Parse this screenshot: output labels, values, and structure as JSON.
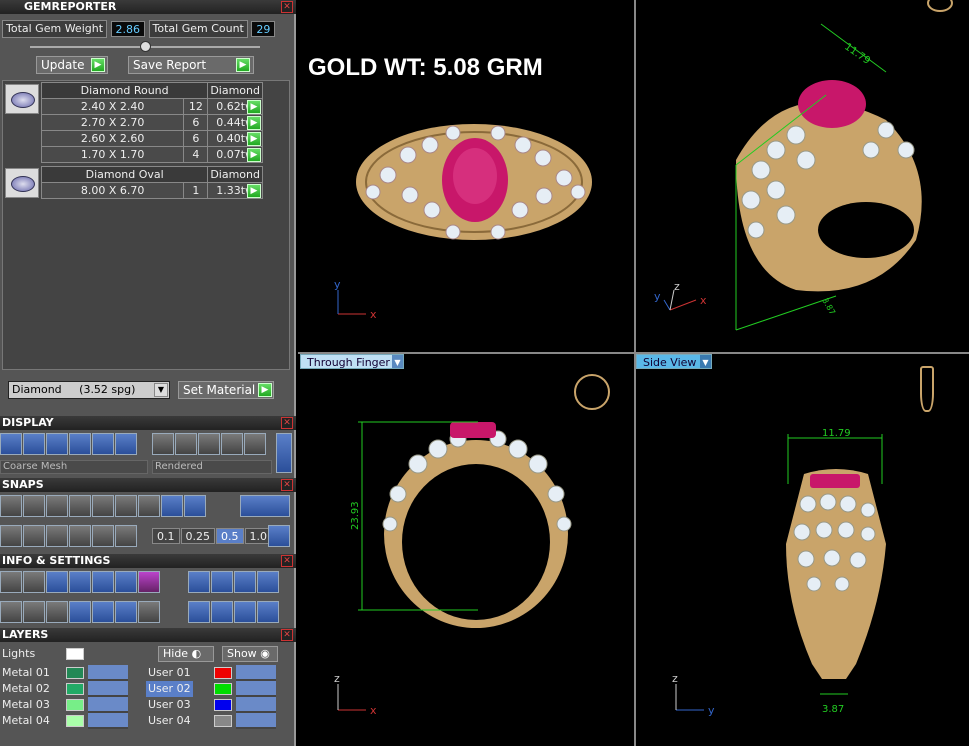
{
  "panel": {
    "title": "GEMREPORTER",
    "total_weight_label": "Total Gem Weight",
    "total_weight_value": "2.86",
    "total_count_label": "Total Gem Count",
    "total_count_value": "29",
    "update_label": "Update",
    "save_report_label": "Save Report",
    "groups": [
      {
        "header": [
          "Diamond Round",
          "Diamond"
        ],
        "rows": [
          [
            "2.40 X 2.40",
            "12",
            "0.62tw"
          ],
          [
            "2.70 X 2.70",
            "6",
            "0.44tw"
          ],
          [
            "2.60 X 2.60",
            "6",
            "0.40tw"
          ],
          [
            "1.70 X 1.70",
            "4",
            "0.07tw"
          ]
        ]
      },
      {
        "header": [
          "Diamond Oval",
          "Diamond"
        ],
        "rows": [
          [
            "8.00 X 6.70",
            "1",
            "1.33tw"
          ]
        ]
      }
    ],
    "material_select": "Diamond     (3.52 spg)",
    "set_material_label": "Set Material"
  },
  "display": {
    "title": "DISPLAY",
    "mesh_select": "Coarse Mesh",
    "render_select": "Rendered"
  },
  "snaps": {
    "title": "SNAPS",
    "values": [
      "0.1",
      "0.25",
      "0.5",
      "1.0"
    ]
  },
  "info": {
    "title": "INFO & SETTINGS"
  },
  "layers": {
    "title": "LAYERS",
    "lights_label": "Lights",
    "hide_label": "Hide",
    "show_label": "Show",
    "metal": [
      {
        "name": "Metal 01",
        "color": "#228855"
      },
      {
        "name": "Metal 02",
        "color": "#22aa66"
      },
      {
        "name": "Metal 03",
        "color": "#77ee88"
      },
      {
        "name": "Metal 04",
        "color": "#aaffaa"
      }
    ],
    "user": [
      {
        "name": "User 01",
        "color": "#ee0000"
      },
      {
        "name": "User 02",
        "color": "#00dd00"
      },
      {
        "name": "User 03",
        "color": "#0000ee"
      },
      {
        "name": "User 04",
        "color": "#888888"
      }
    ]
  },
  "viewports": {
    "gold_weight": "GOLD WT: 5.08 GRM",
    "bottom_left_label": "Through Finger",
    "bottom_right_label": "Side View",
    "dim_top_right": "11.79",
    "dim_top_right_small": "3.87",
    "dim_height": "23.93",
    "dim_side_width": "11.79",
    "dim_side_bottom": "3.87",
    "axis_x": "x",
    "axis_y": "y",
    "axis_z": "z"
  },
  "colors": {
    "gold": "#c9a46a",
    "ruby": "#c8176a",
    "dimension": "#22cc22",
    "axis_x": "#cc3333",
    "axis_y": "#3366cc"
  }
}
